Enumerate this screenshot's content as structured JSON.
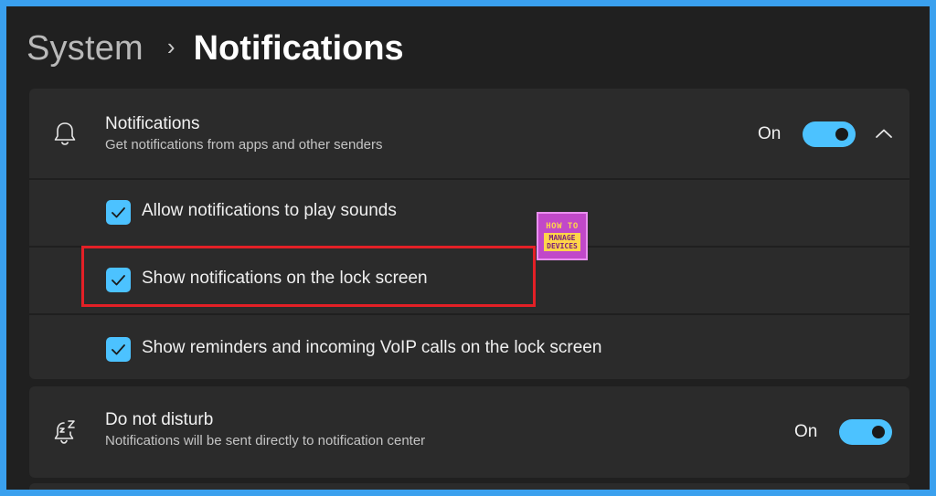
{
  "breadcrumb": {
    "parent": "System",
    "separator": "›",
    "current": "Notifications"
  },
  "notifications": {
    "icon": "bell-icon",
    "title": "Notifications",
    "subtitle": "Get notifications from apps and other senders",
    "toggle_label": "On",
    "toggle_on": true,
    "expanded": true,
    "options": [
      {
        "label": "Allow notifications to play sounds",
        "checked": true
      },
      {
        "label": "Show notifications on the lock screen",
        "checked": true
      },
      {
        "label": "Show reminders and incoming VoIP calls on the lock screen",
        "checked": true
      }
    ]
  },
  "do_not_disturb": {
    "icon": "snooze-bell-icon",
    "title": "Do not disturb",
    "subtitle": "Notifications will be sent directly to notification center",
    "toggle_label": "On",
    "toggle_on": true
  },
  "watermark": {
    "top": "HOW TO",
    "bottom_line1": "MANAGE",
    "bottom_line2": "DEVICES"
  },
  "colors": {
    "accent": "#4cc2ff",
    "highlight": "#e32026",
    "frame": "#3aa0ee",
    "background": "#202020",
    "card": "#2b2b2b"
  }
}
